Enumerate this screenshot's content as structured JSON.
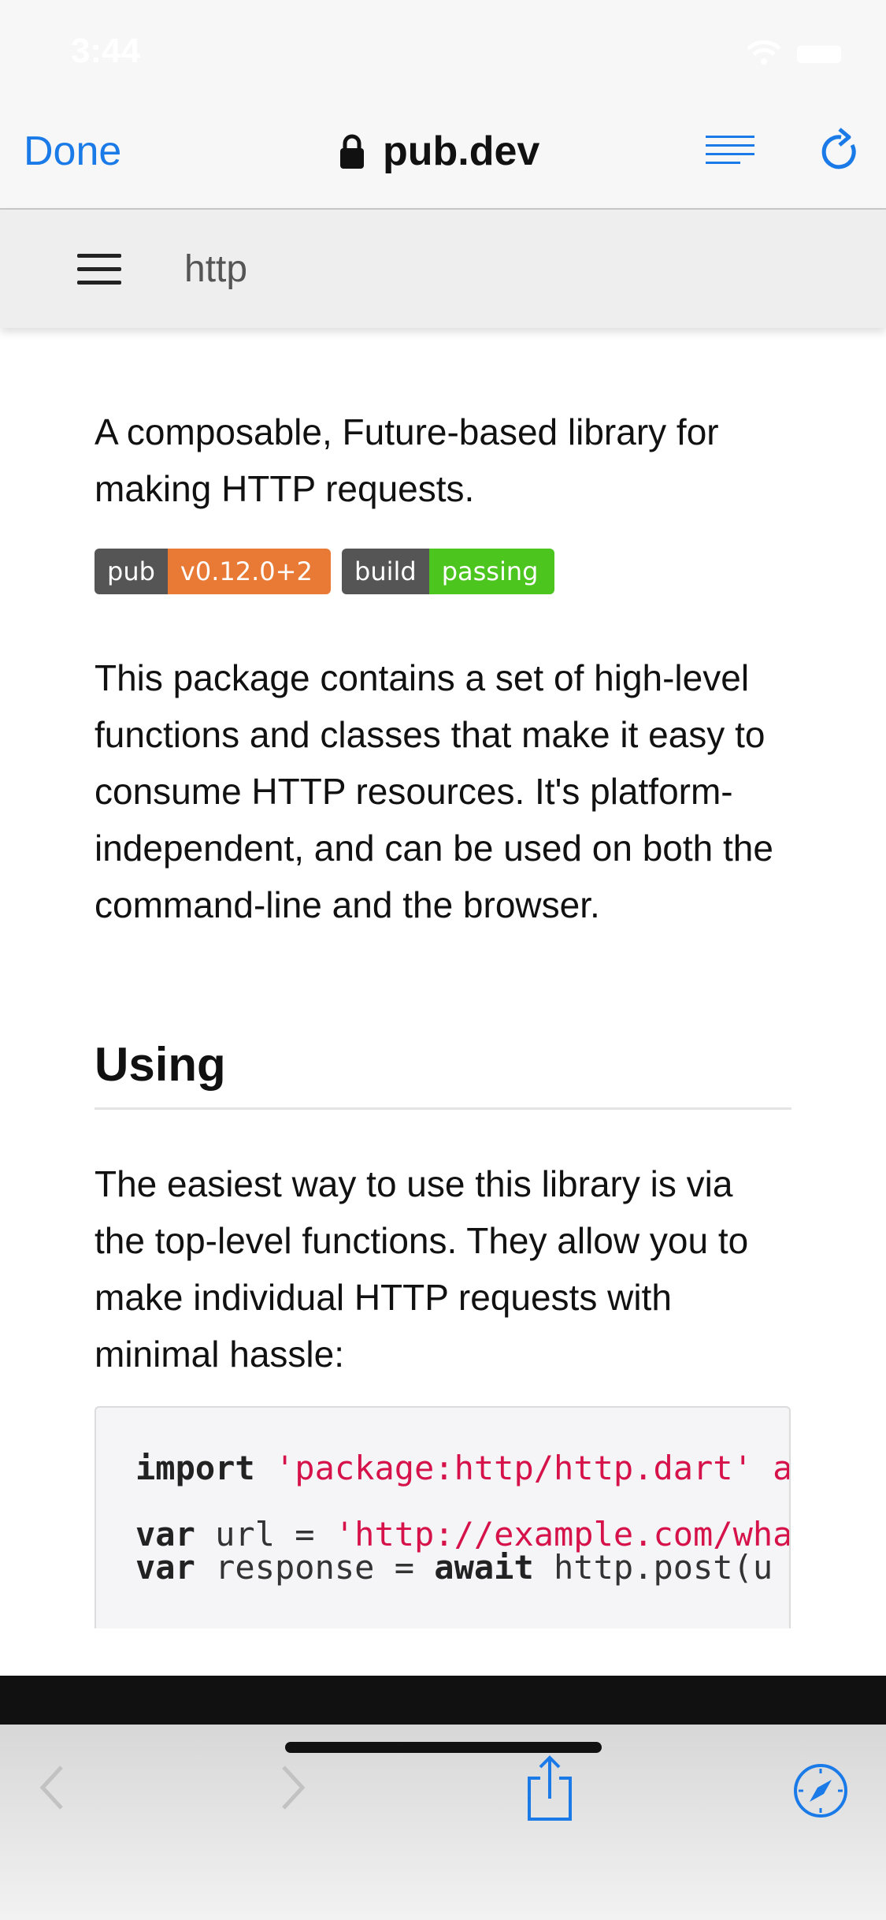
{
  "status_bar": {
    "time": "3:44"
  },
  "safari_toolbar": {
    "done_label": "Done",
    "domain": "pub.dev",
    "accent_color": "#1a7ae8"
  },
  "site_header": {
    "title": "http",
    "menu_icon": "hamburger-icon"
  },
  "content": {
    "tagline": "A composable, Future-based library for making HTTP requests.",
    "badges": [
      {
        "key": "pub",
        "value": "v0.12.0+2",
        "color": "#e97a36"
      },
      {
        "key": "build",
        "value": "passing",
        "color": "#4cc51f"
      }
    ],
    "intro": "This package contains a set of high-level functions and classes that make it easy to consume HTTP resources. It's platform-independent, and can be used on both the command-line and the browser.",
    "section_heading": "Using",
    "using_text": "The easiest way to use this library is via the top-level functions. They allow you to make individual HTTP requests with minimal hassle:",
    "code": {
      "line1_kw": "import",
      "line1_str": "'package:http/http.dart' a",
      "line2_kw": "var",
      "line2_rest": " url = ",
      "line2_str": "'http://example.com/wha",
      "line3_kw1": "var",
      "line3_mid": " response = ",
      "line3_kw2": "await",
      "line3_rest": " http.post(u"
    }
  },
  "bottom_toolbar": {
    "icons": [
      "back-icon",
      "forward-icon",
      "share-icon",
      "compass-icon"
    ]
  }
}
